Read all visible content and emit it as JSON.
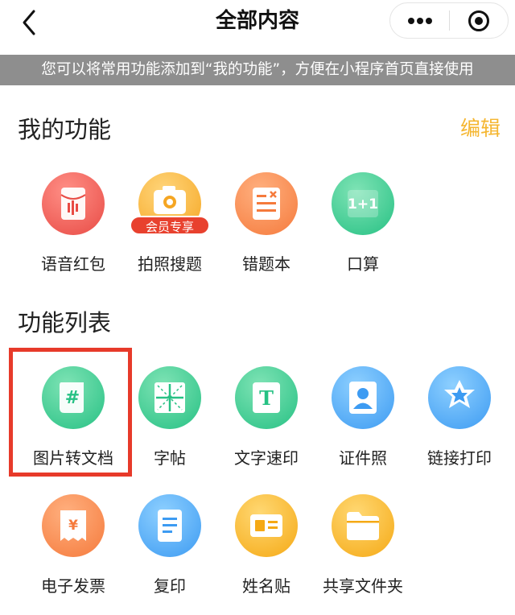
{
  "nav": {
    "title": "全部内容",
    "back_icon": "chevron-left-icon",
    "more_icon": "more-dots-icon",
    "close_icon": "target-close-icon"
  },
  "banner": {
    "text": "您可以将常用功能添加到“我的功能”，方便在小程序首页直接使用"
  },
  "my_functions": {
    "title": "我的功能",
    "edit_label": "编辑",
    "items": [
      {
        "label": "语音红包",
        "icon": "voice-red-envelope-icon",
        "color": "#e84b45"
      },
      {
        "label": "拍照搜题",
        "icon": "camera-icon",
        "color": "#f5a623",
        "badge": "会员专享"
      },
      {
        "label": "错题本",
        "icon": "notebook-icon",
        "color": "#f57a3c"
      },
      {
        "label": "口算",
        "icon": "one-plus-one-icon",
        "color": "#27c184"
      }
    ]
  },
  "function_list": {
    "title": "功能列表",
    "items": [
      {
        "label": "图片转文档",
        "icon": "hash-document-icon",
        "color": "#27c184",
        "highlighted": true
      },
      {
        "label": "字帖",
        "icon": "grid-copybook-icon",
        "color": "#27c184"
      },
      {
        "label": "文字速印",
        "icon": "text-t-icon",
        "color": "#27c184"
      },
      {
        "label": "证件照",
        "icon": "id-photo-icon",
        "color": "#3d9bf2"
      },
      {
        "label": "链接打印",
        "icon": "star-link-icon",
        "color": "#3d9bf2"
      },
      {
        "label": "电子发票",
        "icon": "invoice-icon",
        "color": "#f57a3c"
      },
      {
        "label": "复印",
        "icon": "copy-document-icon",
        "color": "#3d9bf2"
      },
      {
        "label": "姓名贴",
        "icon": "name-tag-icon",
        "color": "#f5a915"
      },
      {
        "label": "共享文件夹",
        "icon": "folder-icon",
        "color": "#f5a915"
      }
    ]
  },
  "highlight_color": "#e73a2a",
  "accent_color": "#f5b630"
}
